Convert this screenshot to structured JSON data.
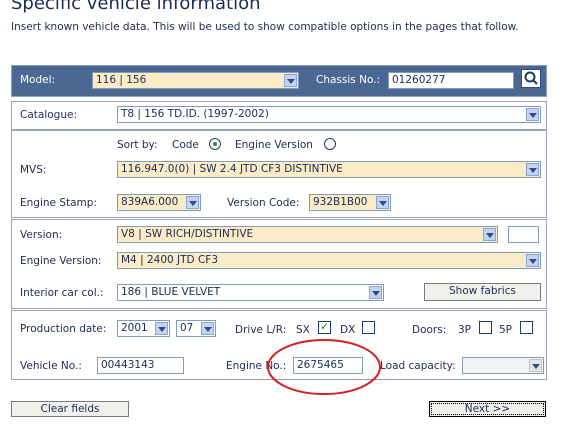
{
  "page": {
    "title": "Specific vehicle information",
    "subtitle": "Insert known vehicle data. This will be used to show compatible options in the pages that follow."
  },
  "model_row": {
    "model_label": "Model:",
    "model_value": "116 | 156",
    "chassis_label": "Chassis No.:",
    "chassis_value": "01260277",
    "search_icon": "search-icon"
  },
  "catalogue": {
    "label": "Catalogue:",
    "value": "T8 | 156 TD.ID. (1997-2002)"
  },
  "mvs_section": {
    "sort_by_label": "Sort by:",
    "sort_code_label": "Code",
    "sort_engine_label": "Engine Version",
    "sort_selected": "Code",
    "mvs_label": "MVS:",
    "mvs_value": "116.947.0(0) | SW 2.4 JTD CF3 DISTINTIVE",
    "engine_stamp_label": "Engine Stamp:",
    "engine_stamp_value": "839A6.000",
    "version_code_label": "Version Code:",
    "version_code_value": "932B1B00"
  },
  "version_section": {
    "version_label": "Version:",
    "version_value": "V8 | SW RICH/DISTINTIVE",
    "version_extra_value": "",
    "engine_version_label": "Engine Version:",
    "engine_version_value": "M4 | 2400 JTD CF3",
    "interior_label": "Interior car col.:",
    "interior_value": "186 | BLUE VELVET",
    "show_fabrics_label": "Show fabrics"
  },
  "production_section": {
    "production_date_label": "Production date:",
    "production_year": "2001",
    "production_month": "07",
    "drive_label": "Drive L/R:",
    "sx_label": "SX",
    "sx_checked": true,
    "dx_label": "DX",
    "dx_checked": false,
    "doors_label": "Doors:",
    "doors_3p_label": "3P",
    "doors_3p_checked": false,
    "doors_5p_label": "5P",
    "doors_5p_checked": false,
    "vehicle_no_label": "Vehicle No.:",
    "vehicle_no_value": "00443143",
    "engine_no_label": "Engine No.:",
    "engine_no_value": "2675465",
    "load_capacity_label": "Load capacity:",
    "load_capacity_value": ""
  },
  "footer": {
    "clear_label": "Clear fields",
    "next_label": "Next >>"
  },
  "colors": {
    "header_bar": "#4a6892",
    "highlight_field": "#fbebc7",
    "annotation_circle": "#d42020"
  }
}
